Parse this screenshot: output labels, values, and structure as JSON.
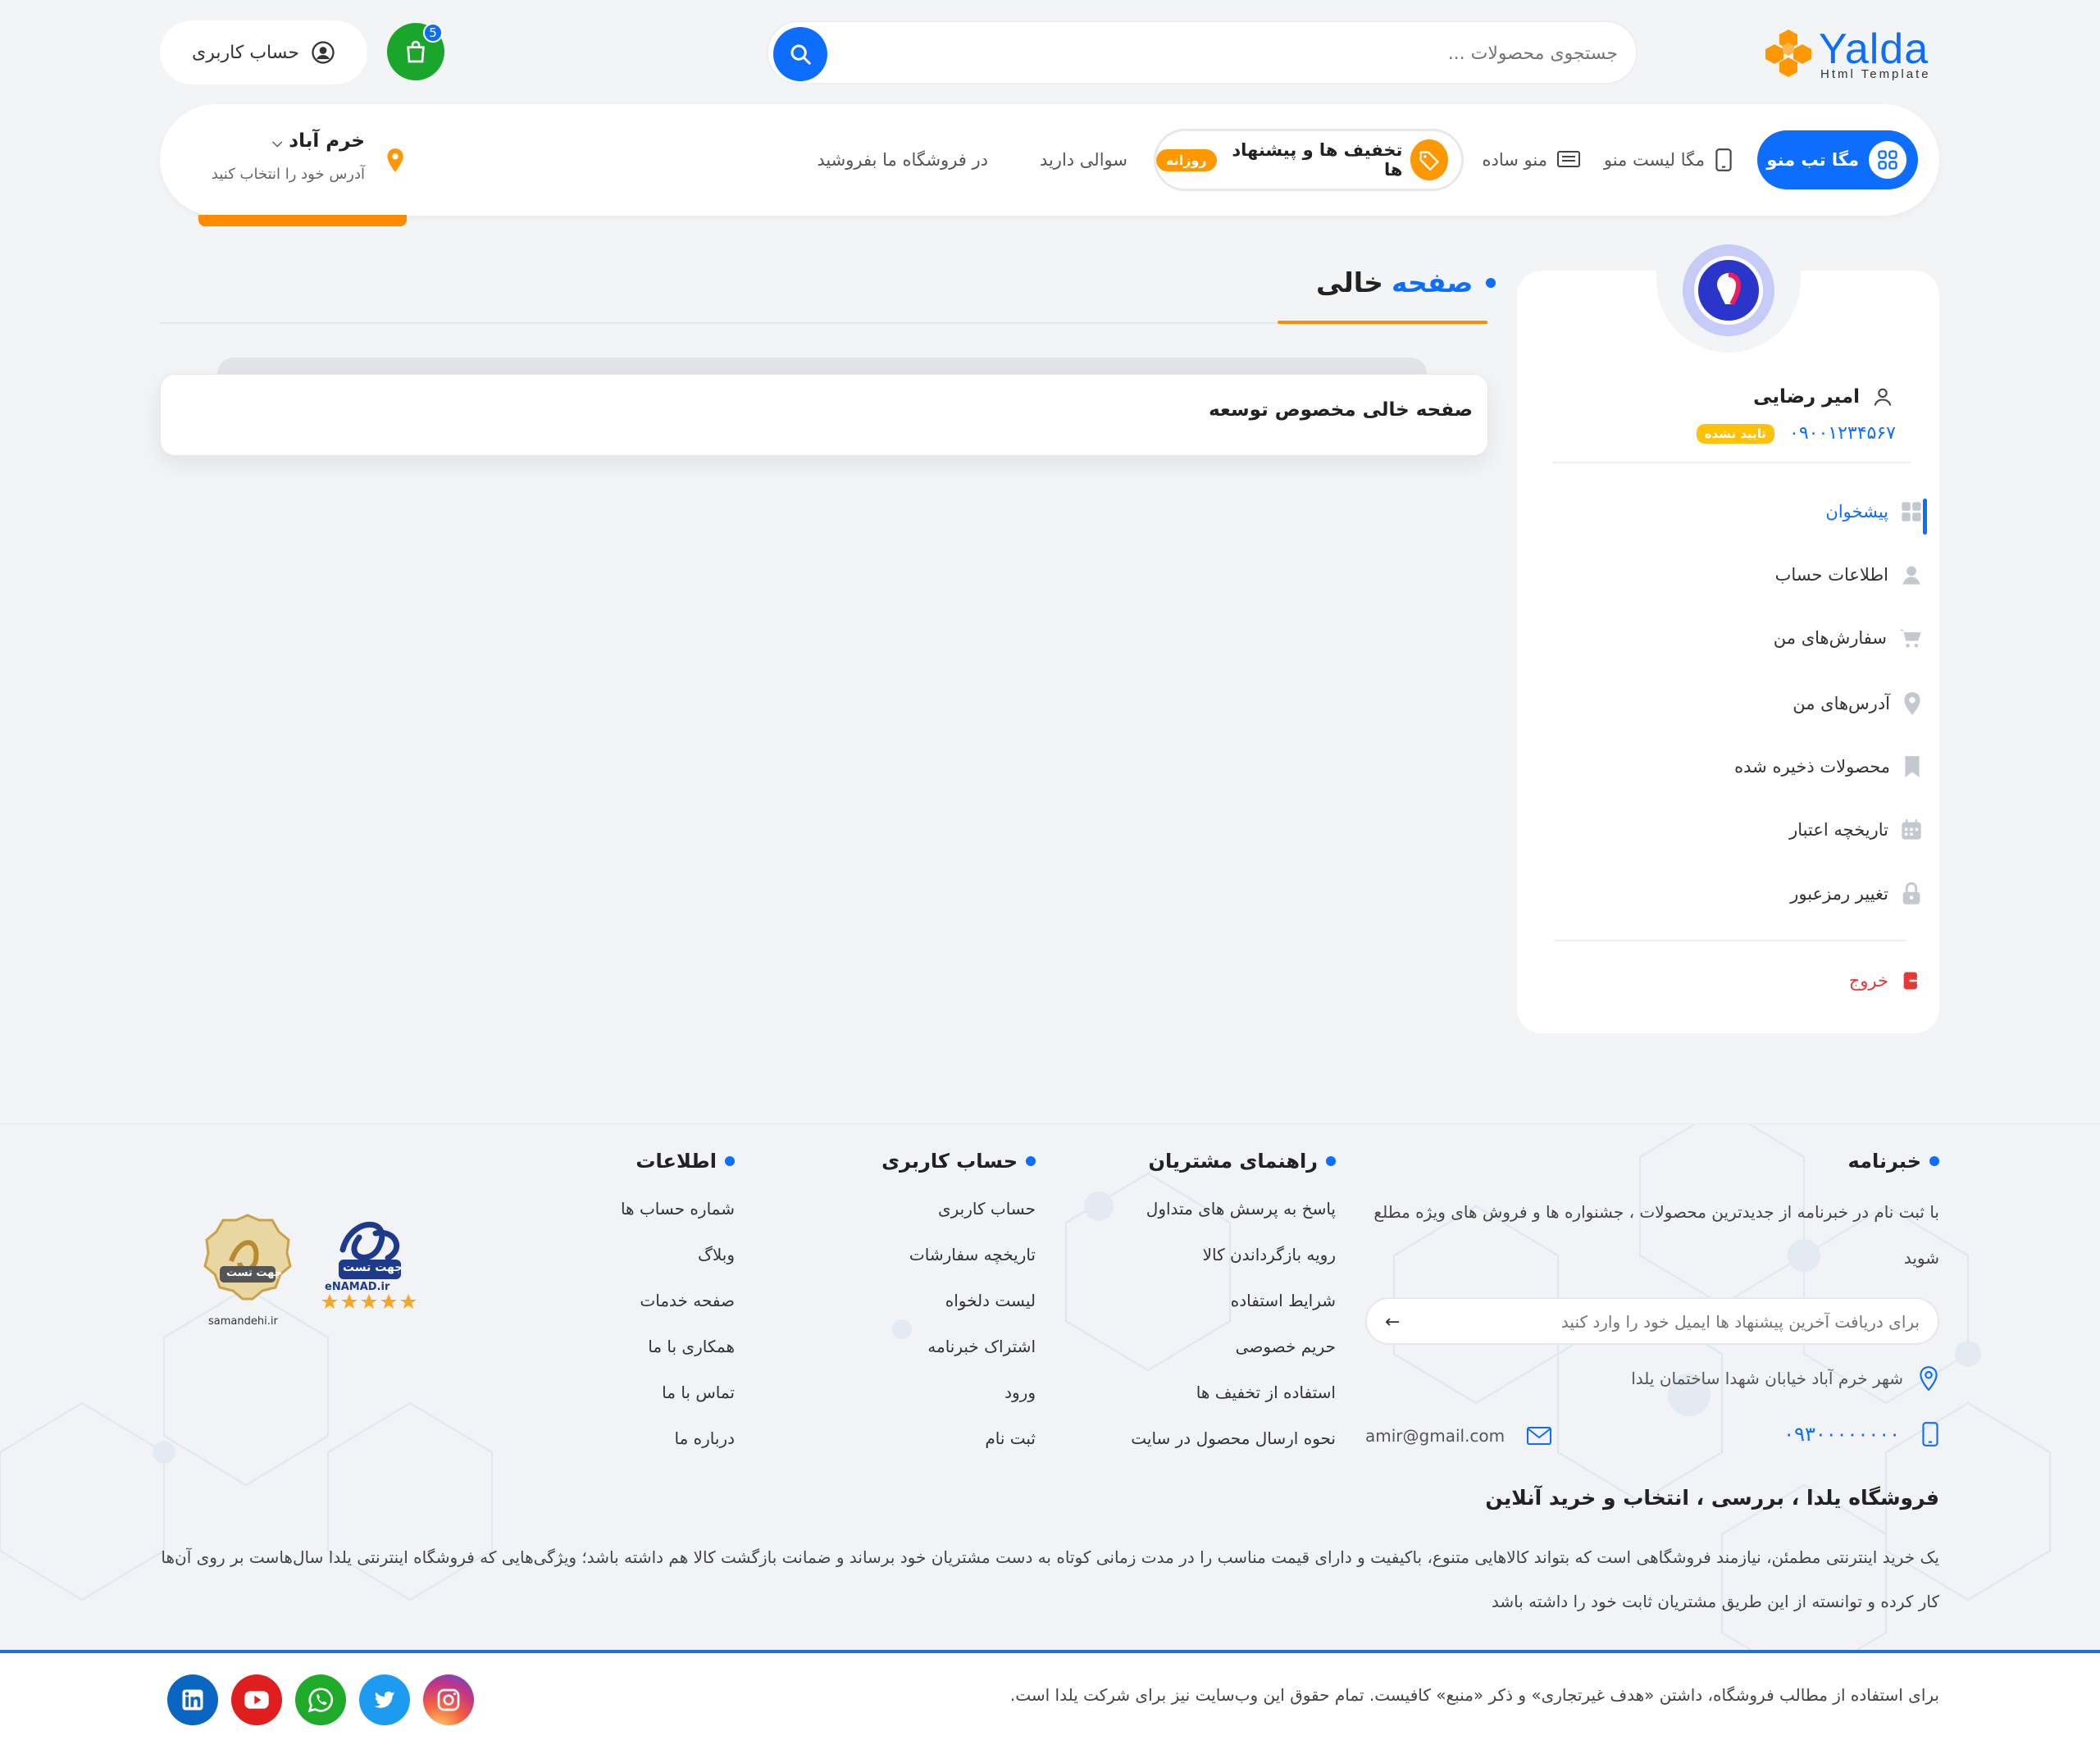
{
  "header": {
    "logo_text": "Yalda",
    "logo_sub": "Html Template",
    "search_placeholder": "جستجوی محصولات ...",
    "cart_count": "5",
    "account_label": "حساب کاربری"
  },
  "nav": {
    "mega_tab": "مگا تب منو",
    "mega_list": "مگا لیست منو",
    "simple_menu": "منو ساده",
    "daily_offers": "تخفیف ها و پیشنهاد ها",
    "daily_badge": "روزانه",
    "question": "سوالی دارید",
    "sell": "در فروشگاه ما بفروشید",
    "city": "خرم آباد",
    "address_hint": "آدرس خود را انتخاب کنید"
  },
  "user": {
    "name": "امیر رضایی",
    "phone": "۰۹۰۰۱۲۳۴۵۶۷",
    "status": "تایید نشده"
  },
  "sidebar": {
    "items": [
      {
        "label": "پیشخوان",
        "icon": "dashboard-icon",
        "active": true
      },
      {
        "label": "اطلاعات حساب",
        "icon": "user-icon"
      },
      {
        "label": "سفارش‌های من",
        "icon": "cart-icon"
      },
      {
        "label": "آدرس‌های من",
        "icon": "location-icon"
      },
      {
        "label": "محصولات ذخیره شده",
        "icon": "bookmark-icon"
      },
      {
        "label": "تاریخچه اعتبار",
        "icon": "calendar-icon"
      },
      {
        "label": "تغییر رمزعبور",
        "icon": "lock-icon"
      }
    ],
    "logout": "خروج"
  },
  "main": {
    "title_blue": "صفحه",
    "title_dark": "خالی",
    "card_text": "صفحه خالی مخصوص توسعه"
  },
  "footer": {
    "newsletter_title": "خبرنامه",
    "newsletter_text": "با ثبت نام در خبرنامه از جدیدترین محصولات ، جشنواره ها و فروش های ویژه مطلع شوید",
    "newsletter_placeholder": "برای دریافت آخرین پیشنهاد ها ایمیل خود را وارد کنید",
    "address": "شهر خرم آباد خیابان شهدا ساختمان یلدا",
    "phone": "۰۹۳۰۰۰۰۰۰۰۰",
    "email": "amir@gmail.com",
    "guide_title": "راهنمای مشتریان",
    "guide_links": [
      "پاسخ به پرسش های متداول",
      "رویه بازگرداندن کالا",
      "شرایط استفاده",
      "حریم خصوصی",
      "استفاده از تخفیف ها",
      "نحوه ارسال محصول در سایت"
    ],
    "account_title": "حساب کاربری",
    "account_links": [
      "حساب کاربری",
      "تاریخچه سفارشات",
      "لیست دلخواه",
      "اشتراک خبرنامه",
      "ورود",
      "ثبت نام"
    ],
    "info_title": "اطلاعات",
    "info_links": [
      "شماره حساب ها",
      "وبلاگ",
      "صفحه خدمات",
      "همکاری با ما",
      "تماس با ما",
      "درباره ما"
    ],
    "enamad_text": "جهت تست",
    "enamad_sub": "eNAMAD.ir",
    "samandehi_text": "جهت تست",
    "samandehi_sub": "samandehi.ir",
    "about_title": "فروشگاه یلدا ، بررسی ، انتخاب و خرید آنلاین",
    "about_text": "یک خرید اینترنتی مطمئن، نیازمند فروشگاهی است که بتواند کالاهایی متنوع، باکیفیت و دارای قیمت مناسب را در مدت زمانی کوتاه به دست مشتریان خود برساند و ضمانت بازگشت کالا هم داشته باشد؛ ویژگی‌هایی که فروشگاه اینترنتی یلدا سال‌هاست بر روی آن‌ها کار کرده و توانسته از این طریق مشتریان ثابت خود را داشته باشد",
    "copyright": "برای استفاده از مطالب فروشگاه، داشتن «هدف غیرتجاری» و ذکر «منبع» کافیست. تمام حقوق این وب‌سایت نیز برای شرکت یلدا است.",
    "social": [
      {
        "name": "instagram-icon",
        "color": "#e1306c"
      },
      {
        "name": "twitter-icon",
        "color": "#1d9bf0"
      },
      {
        "name": "whatsapp-icon",
        "color": "#1faa2a"
      },
      {
        "name": "youtube-icon",
        "color": "#e01e1e"
      },
      {
        "name": "linkedin-icon",
        "color": "#0a66c2"
      }
    ]
  }
}
